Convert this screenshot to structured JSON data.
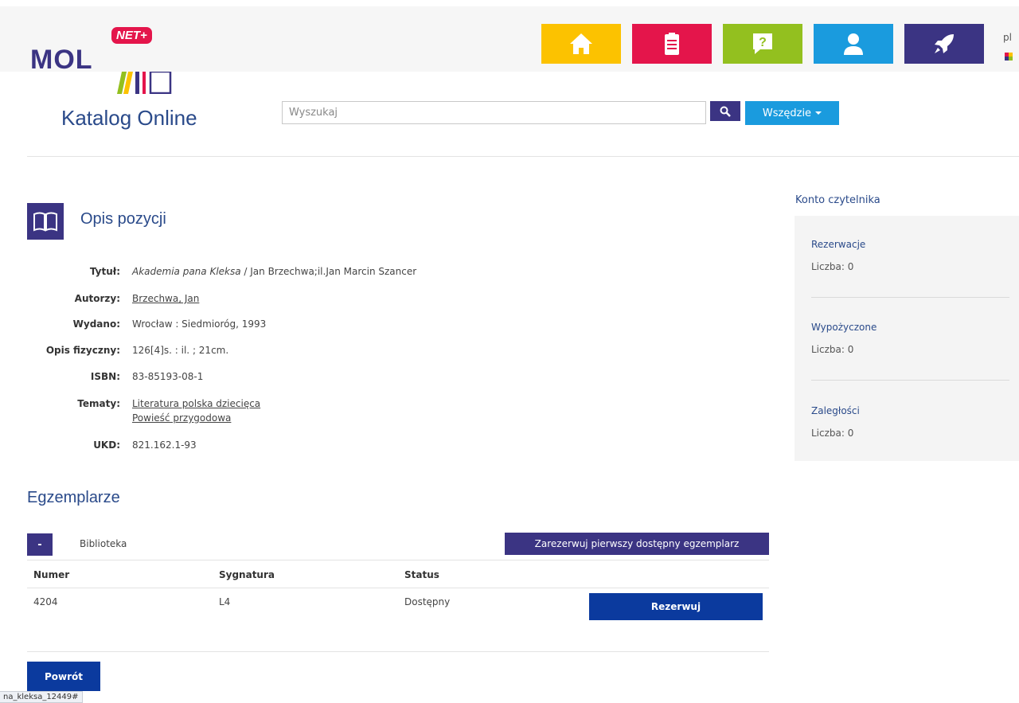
{
  "header": {
    "logo_text": "MOL",
    "logo_badge": "NET+",
    "brand": "Katalog Online",
    "language": "pl",
    "nav": [
      {
        "name": "home",
        "color": "#fcc200",
        "icon": "home-icon"
      },
      {
        "name": "notes",
        "color": "#e4154b",
        "icon": "clipboard-icon"
      },
      {
        "name": "help",
        "color": "#93c01f",
        "icon": "help-icon"
      },
      {
        "name": "account",
        "color": "#1a9bde",
        "icon": "user-icon"
      },
      {
        "name": "rocket",
        "color": "#3b3483",
        "icon": "rocket-icon"
      }
    ]
  },
  "search": {
    "placeholder": "Wyszukaj",
    "value": "",
    "scope_label": "Wszędzie"
  },
  "description": {
    "heading": "Opis pozycji",
    "title_label": "Tytuł:",
    "title_italic": "Akademia pana Kleksa",
    "title_rest": " / Jan Brzechwa;il.Jan Marcin Szancer",
    "authors_label": "Autorzy:",
    "author": "Brzechwa, Jan",
    "published_label": "Wydano:",
    "published": "Wrocław : Siedmioróg, 1993",
    "physical_label": "Opis fizyczny:",
    "physical": "126[4]s. : il. ; 21cm.",
    "isbn_label": "ISBN:",
    "isbn": "83-85193-08-1",
    "topics_label": "Tematy:",
    "topics": [
      "Literatura polska dziecięca",
      "Powieść przygodowa"
    ],
    "ukd_label": "UKD:",
    "ukd": "821.162.1-93"
  },
  "copies": {
    "heading": "Egzemplarze",
    "toggle": "-",
    "library_label": "Biblioteka",
    "reserve_first": "Zarezerwuj pierwszy dostępny egzemplarz",
    "columns": [
      "Numer",
      "Sygnatura",
      "Status"
    ],
    "rows": [
      {
        "number": "4204",
        "signature": "L4",
        "status": "Dostępny",
        "action": "Rezerwuj"
      }
    ],
    "back": "Powrót"
  },
  "account": {
    "heading": "Konto czytelnika",
    "items": [
      {
        "label": "Rezerwacje",
        "count": "Liczba: 0"
      },
      {
        "label": "Wypożyczone",
        "count": "Liczba: 0"
      },
      {
        "label": "Zaległości",
        "count": "Liczba: 0"
      }
    ]
  },
  "statusbar": {
    "url": "na_kleksa_12449#"
  }
}
